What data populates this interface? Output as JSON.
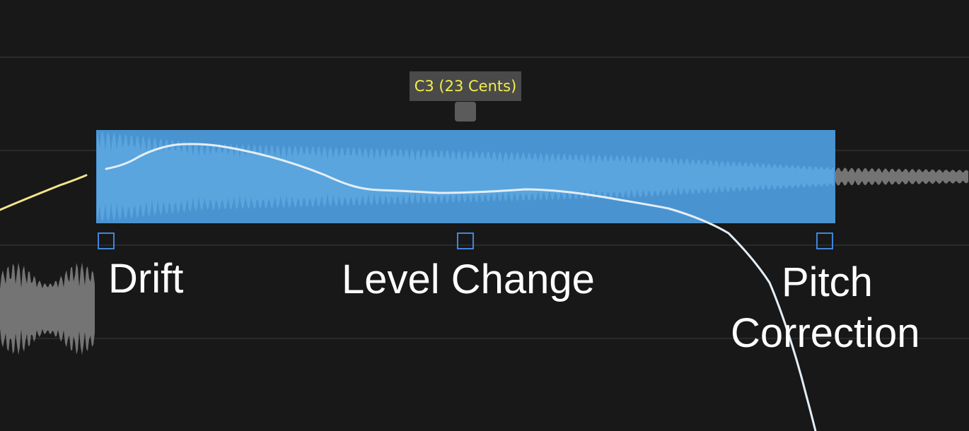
{
  "colors": {
    "background": "#181818",
    "grid_line": "#2a2a2a",
    "selection_fill": "#4a93d1",
    "selection_waveform": "#5aa5de",
    "inactive_waveform": "#747474",
    "pitch_curve": "#e4eef7",
    "previous_pitch_curve": "#f2e58b",
    "handle_outline": "#3f86db",
    "tooltip_background": "#4a4a4a",
    "tooltip_text": "#f4ef4a",
    "label_text": "#ffffff"
  },
  "tooltip": {
    "label": "C3 (23 Cents)"
  },
  "labels": {
    "drift": "Drift",
    "level_change": "Level Change",
    "pitch_line1": "Pitch",
    "pitch_line2": "Correction"
  },
  "icons": {
    "pitch_knob": "grab-handle-icon",
    "anchor_handles": "square-outline-icon"
  }
}
